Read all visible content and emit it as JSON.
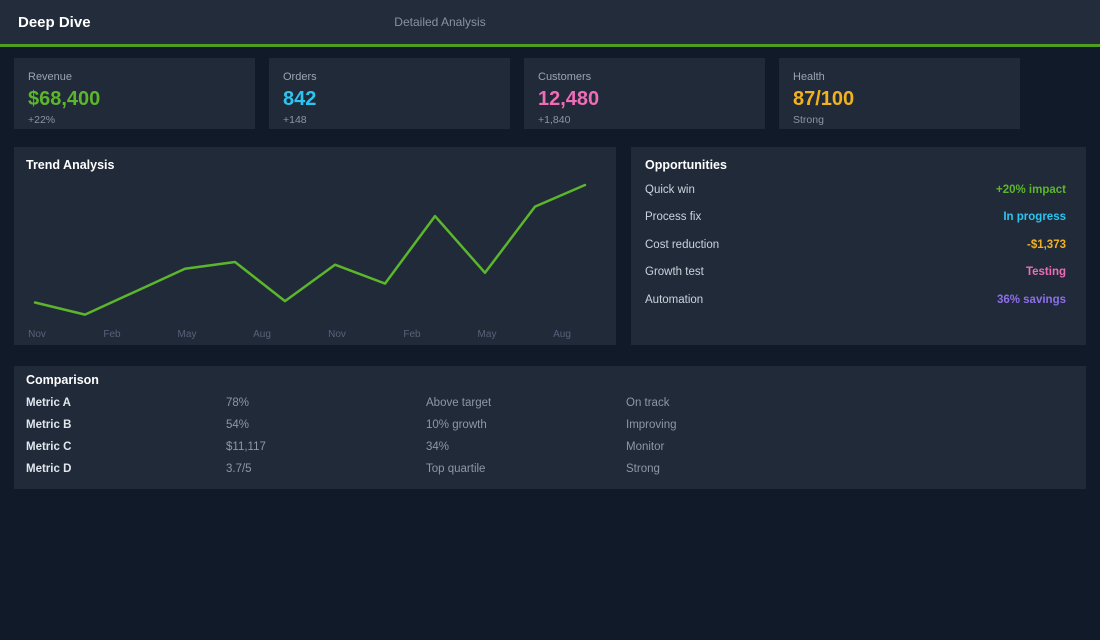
{
  "header": {
    "title": "Deep Dive",
    "subtitle": "Detailed Analysis"
  },
  "colors": {
    "accent_green": "#4f9e20",
    "page_bg": "#111a28",
    "header_bg": "#222c3b",
    "panel_bg": "#202a39"
  },
  "stat_cards": [
    {
      "label": "Revenue",
      "value": "$68,400",
      "delta": "+22%",
      "color": "#5cb62c"
    },
    {
      "label": "Orders",
      "value": "842",
      "delta": "+148",
      "color": "#2cc4f0"
    },
    {
      "label": "Customers",
      "value": "12,480",
      "delta": "+1,840",
      "color": "#ee6db6"
    },
    {
      "label": "Health",
      "value": "87/100",
      "delta": "Strong",
      "color": "#f2b11f"
    }
  ],
  "trend": {
    "title": "Trend Analysis",
    "chart_data": {
      "type": "line",
      "x_labels": [
        "Nov",
        "Feb",
        "May",
        "Aug",
        "Nov",
        "Feb",
        "May",
        "Aug"
      ],
      "values": [
        13,
        4,
        21,
        38,
        43,
        14,
        41,
        27,
        77,
        35,
        84,
        100
      ],
      "ylim": [
        0,
        100
      ],
      "line_color": "#5cb62c",
      "axis_label_color": "#58627a",
      "grid": false,
      "legend": false
    }
  },
  "opportunities": {
    "title": "Opportunities",
    "items": [
      {
        "label": "Quick win",
        "value": "+20% impact",
        "color": "#5cb62c"
      },
      {
        "label": "Process fix",
        "value": "In progress",
        "color": "#2cc4f0"
      },
      {
        "label": "Cost reduction",
        "value": "-$1,373",
        "color": "#f2b11f"
      },
      {
        "label": "Growth test",
        "value": "Testing",
        "color": "#ee6db6"
      },
      {
        "label": "Automation",
        "value": "36% savings",
        "color": "#8d6fe8"
      }
    ]
  },
  "comparison": {
    "title": "Comparison",
    "rows": [
      {
        "name": "Metric A",
        "values": [
          "78%",
          "Above target",
          "On track"
        ]
      },
      {
        "name": "Metric B",
        "values": [
          "54%",
          "10% growth",
          "Improving"
        ]
      },
      {
        "name": "Metric C",
        "values": [
          "$11,117",
          "34%",
          "Monitor"
        ]
      },
      {
        "name": "Metric D",
        "values": [
          "3.7/5",
          "Top quartile",
          "Strong"
        ]
      }
    ]
  }
}
